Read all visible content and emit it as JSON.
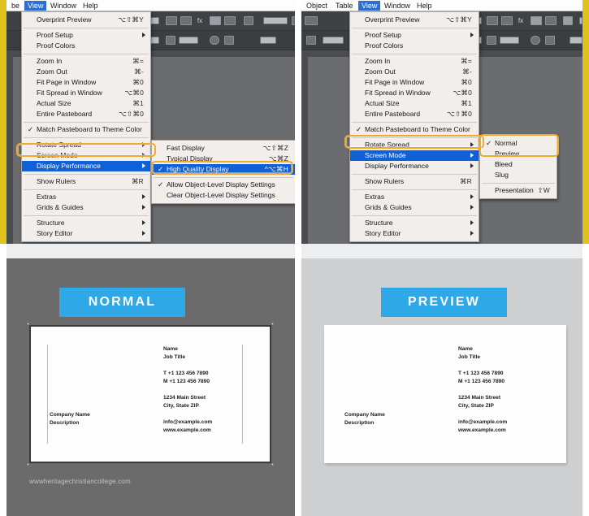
{
  "left_screenshot": {
    "menubar": [
      {
        "label": "be",
        "active": false
      },
      {
        "label": "View",
        "active": true
      },
      {
        "label": "Window",
        "active": false
      },
      {
        "label": "Help",
        "active": false
      }
    ],
    "view_menu": {
      "groups": [
        [
          {
            "label": "Overprint Preview",
            "shortcut": "⌥⇧⌘Y",
            "checked": false,
            "submenu": false
          }
        ],
        [
          {
            "label": "Proof Setup",
            "shortcut": "",
            "checked": false,
            "submenu": true
          },
          {
            "label": "Proof Colors",
            "shortcut": "",
            "checked": false,
            "submenu": false
          }
        ],
        [
          {
            "label": "Zoom In",
            "shortcut": "⌘=",
            "checked": false,
            "submenu": false
          },
          {
            "label": "Zoom Out",
            "shortcut": "⌘-",
            "checked": false,
            "submenu": false
          },
          {
            "label": "Fit Page in Window",
            "shortcut": "⌘0",
            "checked": false,
            "submenu": false
          },
          {
            "label": "Fit Spread in Window",
            "shortcut": "⌥⌘0",
            "checked": false,
            "submenu": false
          },
          {
            "label": "Actual Size",
            "shortcut": "⌘1",
            "checked": false,
            "submenu": false
          },
          {
            "label": "Entire Pasteboard",
            "shortcut": "⌥⇧⌘0",
            "checked": false,
            "submenu": false
          }
        ],
        [
          {
            "label": "Match Pasteboard to Theme Color",
            "shortcut": "",
            "checked": true,
            "submenu": false
          }
        ],
        [
          {
            "label": "Rotate Spread",
            "shortcut": "",
            "checked": false,
            "submenu": true
          },
          {
            "label": "Screen Mode",
            "shortcut": "",
            "checked": false,
            "submenu": true
          },
          {
            "label": "Display Performance",
            "shortcut": "",
            "checked": false,
            "submenu": true,
            "selected": true
          }
        ],
        [
          {
            "label": "Show Rulers",
            "shortcut": "⌘R",
            "checked": false,
            "submenu": false
          }
        ],
        [
          {
            "label": "Extras",
            "shortcut": "",
            "checked": false,
            "submenu": true
          },
          {
            "label": "Grids & Guides",
            "shortcut": "",
            "checked": false,
            "submenu": true
          }
        ],
        [
          {
            "label": "Structure",
            "shortcut": "",
            "checked": false,
            "submenu": true
          },
          {
            "label": "Story Editor",
            "shortcut": "",
            "checked": false,
            "submenu": true
          }
        ]
      ]
    },
    "submenu": {
      "title": "Display Performance",
      "groups": [
        [
          {
            "label": "Fast Display",
            "shortcut": "⌥⇧⌘Z",
            "checked": false
          },
          {
            "label": "Typical Display",
            "shortcut": "⌥⌘Z",
            "checked": false
          },
          {
            "label": "High Quality Display",
            "shortcut": "^⌥⌘H",
            "checked": true,
            "selected": true
          }
        ],
        [
          {
            "label": "Allow Object-Level Display Settings",
            "shortcut": "",
            "checked": true
          },
          {
            "label": "Clear Object-Level Display Settings",
            "shortcut": "",
            "checked": false
          }
        ]
      ]
    }
  },
  "right_screenshot": {
    "menubar": [
      {
        "label": "Object",
        "active": false
      },
      {
        "label": "Table",
        "active": false
      },
      {
        "label": "View",
        "active": true
      },
      {
        "label": "Window",
        "active": false
      },
      {
        "label": "Help",
        "active": false
      }
    ],
    "view_menu": {
      "groups": [
        [
          {
            "label": "Overprint Preview",
            "shortcut": "⌥⇧⌘Y",
            "checked": false,
            "submenu": false
          }
        ],
        [
          {
            "label": "Proof Setup",
            "shortcut": "",
            "checked": false,
            "submenu": true
          },
          {
            "label": "Proof Colors",
            "shortcut": "",
            "checked": false,
            "submenu": false
          }
        ],
        [
          {
            "label": "Zoom In",
            "shortcut": "⌘=",
            "checked": false,
            "submenu": false
          },
          {
            "label": "Zoom Out",
            "shortcut": "⌘-",
            "checked": false,
            "submenu": false
          },
          {
            "label": "Fit Page in Window",
            "shortcut": "⌘0",
            "checked": false,
            "submenu": false
          },
          {
            "label": "Fit Spread in Window",
            "shortcut": "⌥⌘0",
            "checked": false,
            "submenu": false
          },
          {
            "label": "Actual Size",
            "shortcut": "⌘1",
            "checked": false,
            "submenu": false
          },
          {
            "label": "Entire Pasteboard",
            "shortcut": "⌥⇧⌘0",
            "checked": false,
            "submenu": false
          }
        ],
        [
          {
            "label": "Match Pasteboard to Theme Color",
            "shortcut": "",
            "checked": true,
            "submenu": false
          }
        ],
        [
          {
            "label": "Rotate Spread",
            "shortcut": "",
            "checked": false,
            "submenu": true
          },
          {
            "label": "Screen Mode",
            "shortcut": "",
            "checked": false,
            "submenu": true,
            "selected": true
          },
          {
            "label": "Display Performance",
            "shortcut": "",
            "checked": false,
            "submenu": true
          }
        ],
        [
          {
            "label": "Show Rulers",
            "shortcut": "⌘R",
            "checked": false,
            "submenu": false
          }
        ],
        [
          {
            "label": "Extras",
            "shortcut": "",
            "checked": false,
            "submenu": true
          },
          {
            "label": "Grids & Guides",
            "shortcut": "",
            "checked": false,
            "submenu": true
          }
        ],
        [
          {
            "label": "Structure",
            "shortcut": "",
            "checked": false,
            "submenu": true
          },
          {
            "label": "Story Editor",
            "shortcut": "",
            "checked": false,
            "submenu": true
          }
        ]
      ]
    },
    "submenu": {
      "title": "Screen Mode",
      "groups": [
        [
          {
            "label": "Normal",
            "shortcut": "",
            "checked": true
          },
          {
            "label": "Preview",
            "shortcut": "",
            "checked": false
          },
          {
            "label": "Bleed",
            "shortcut": "",
            "checked": false
          },
          {
            "label": "Slug",
            "shortcut": "",
            "checked": false
          }
        ],
        [
          {
            "label": "Presentation",
            "shortcut": "⇧W",
            "checked": false
          }
        ]
      ]
    }
  },
  "comparison": {
    "left": {
      "badge_label": "NORMAL",
      "badge_color": "#2fa8e8",
      "background_color": "#6b6b6b",
      "show_frames": true,
      "card": {
        "company_name": "Company Name",
        "description": "Description",
        "name": "Name",
        "job_title": "Job Title",
        "phone_t": "T  +1 123 456 7890",
        "phone_m": "M +1 123 456 7890",
        "address_street": "1234 Main Street",
        "address_city": "City, State ZIP",
        "email": "info@example.com",
        "website": "www.example.com"
      }
    },
    "right": {
      "badge_label": "PREVIEW",
      "badge_color": "#2fa8e8",
      "background_color": "#cdcfd1",
      "show_frames": false,
      "card": {
        "company_name": "Company Name",
        "description": "Description",
        "name": "Name",
        "job_title": "Job Title",
        "phone_t": "T  +1 123 456 7890",
        "phone_m": "M +1 123 456 7890",
        "address_street": "1234 Main Street",
        "address_city": "City, State ZIP",
        "email": "info@example.com",
        "website": "www.example.com"
      }
    }
  },
  "watermark": "wwwheritagechristiancollege.com",
  "accent": {
    "highlight_outline": "#f0a92b",
    "menu_selection": "#1060d8",
    "gold_frame": "#e0c21f"
  }
}
